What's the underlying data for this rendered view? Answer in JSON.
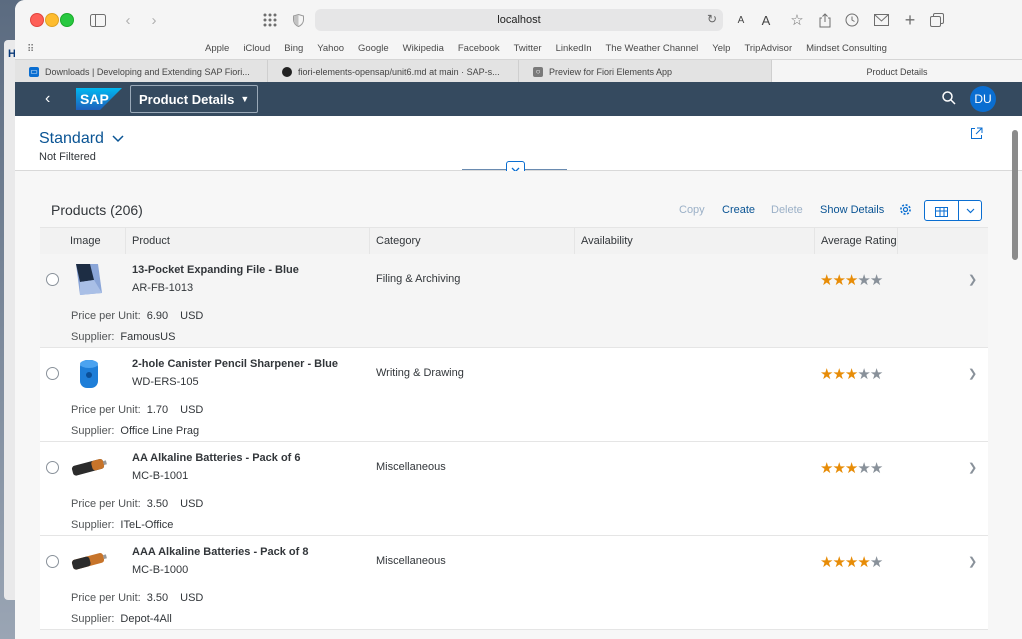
{
  "browser": {
    "url": "localhost",
    "favorites": [
      "Apple",
      "iCloud",
      "Bing",
      "Yahoo",
      "Google",
      "Wikipedia",
      "Facebook",
      "Twitter",
      "LinkedIn",
      "The Weather Channel",
      "Yelp",
      "TripAdvisor",
      "Mindset Consulting"
    ],
    "tabs": [
      {
        "label": "Downloads | Developing and Extending SAP Fiori..."
      },
      {
        "label": "fiori-elements-opensap/unit6.md at main · SAP-s..."
      },
      {
        "label": "Preview for Fiori Elements App"
      },
      {
        "label": "Product Details"
      }
    ]
  },
  "shell": {
    "title": "Product Details",
    "avatar": "DU"
  },
  "filter": {
    "variant": "Standard",
    "status": "Not Filtered"
  },
  "table": {
    "title": "Products (206)",
    "actions": {
      "copy": "Copy",
      "create": "Create",
      "delete": "Delete",
      "show_details": "Show Details"
    },
    "columns": {
      "image": "Image",
      "product": "Product",
      "category": "Category",
      "availability": "Availability",
      "rating": "Average Rating"
    },
    "price_label": "Price per Unit:",
    "supplier_label": "Supplier:",
    "rows": [
      {
        "name": "13-Pocket Expanding File - Blue",
        "id": "AR-FB-1013",
        "category": "Filing & Archiving",
        "rating": 3,
        "price": "6.90",
        "currency": "USD",
        "supplier": "FamousUS"
      },
      {
        "name": "2-hole Canister Pencil Sharpener - Blue",
        "id": "WD-ERS-105",
        "category": "Writing & Drawing",
        "rating": 3,
        "price": "1.70",
        "currency": "USD",
        "supplier": "Office Line Prag"
      },
      {
        "name": "AA Alkaline Batteries - Pack of 6",
        "id": "MC-B-1001",
        "category": "Miscellaneous",
        "rating": 3,
        "price": "3.50",
        "currency": "USD",
        "supplier": "ITeL-Office"
      },
      {
        "name": "AAA Alkaline Batteries - Pack of 8",
        "id": "MC-B-1000",
        "category": "Miscellaneous",
        "rating": 4,
        "price": "3.50",
        "currency": "USD",
        "supplier": "Depot-4All"
      }
    ]
  },
  "colors": {
    "shell": "#354a5f",
    "accent": "#0a6ed1",
    "star": "#e78c07"
  }
}
